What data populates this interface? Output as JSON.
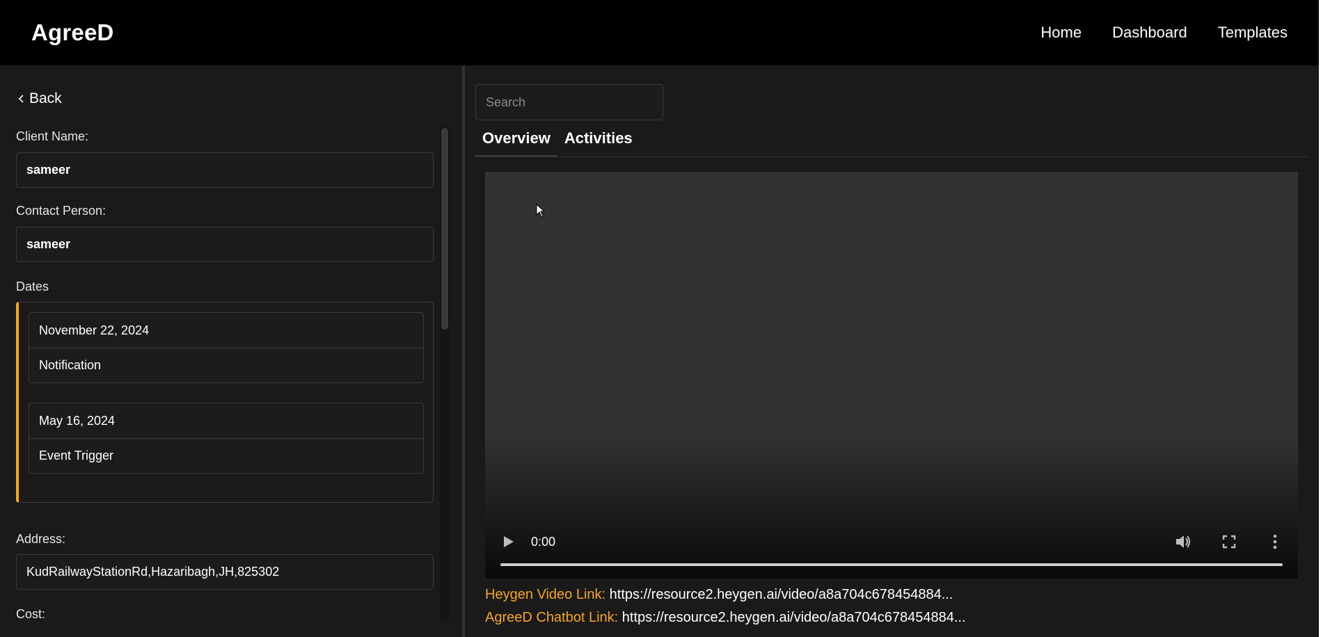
{
  "header": {
    "brand": "AgreeD",
    "nav": [
      "Home",
      "Dashboard",
      "Templates"
    ]
  },
  "left": {
    "back_label": "Back",
    "client_name_label": "Client Name:",
    "client_name_value": "sameer",
    "contact_person_label": "Contact Person:",
    "contact_person_value": "sameer",
    "dates_label": "Dates",
    "dates": [
      {
        "date": "November 22, 2024",
        "type": "Notification"
      },
      {
        "date": "May 16, 2024",
        "type": "Event Trigger"
      }
    ],
    "address_label": "Address:",
    "address_value": "KudRailwayStationRd,Hazaribagh,JH,825302",
    "cost_label": "Cost:"
  },
  "right": {
    "search_placeholder": "Search",
    "tabs": [
      "Overview",
      "Activities"
    ],
    "active_tab": "Overview",
    "video": {
      "time": "0:00",
      "progress": 0
    },
    "heygen_label": "Heygen Video Link:",
    "heygen_value": "https://resource2.heygen.ai/video/a8a704c678454884...",
    "chatbot_label": "AgreeD Chatbot Link:",
    "chatbot_value": "https://resource2.heygen.ai/video/a8a704c678454884..."
  },
  "colors": {
    "accent": "#f5a623",
    "header_bg": "#000000",
    "panel_bg": "#1a1a1a"
  }
}
